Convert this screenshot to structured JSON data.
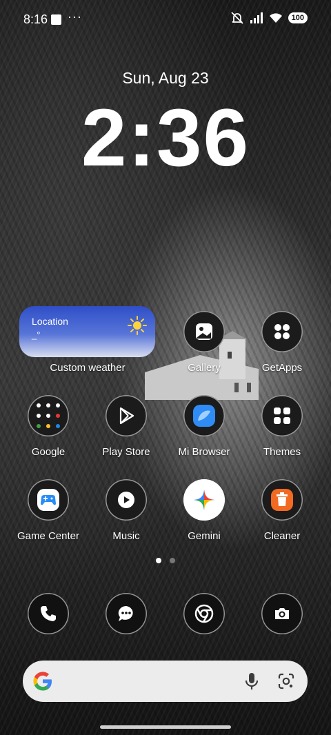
{
  "status_bar": {
    "time": "8:16",
    "battery": "100"
  },
  "lock": {
    "date": "Sun, Aug 23",
    "clock": "2:36"
  },
  "weather_widget": {
    "location": "Location",
    "value": "_°",
    "label": "Custom weather"
  },
  "apps": [
    {
      "label": "Gallery"
    },
    {
      "label": "GetApps"
    },
    {
      "label": "Google"
    },
    {
      "label": "Play Store"
    },
    {
      "label": "Mi Browser"
    },
    {
      "label": "Themes"
    },
    {
      "label": "Game Center"
    },
    {
      "label": "Music"
    },
    {
      "label": "Gemini"
    },
    {
      "label": "Cleaner"
    }
  ],
  "dock": [
    {
      "icon": "phone-icon"
    },
    {
      "icon": "messages-icon"
    },
    {
      "icon": "chrome-icon"
    },
    {
      "icon": "camera-icon"
    }
  ],
  "pager": {
    "pages": 2,
    "current": 1
  }
}
